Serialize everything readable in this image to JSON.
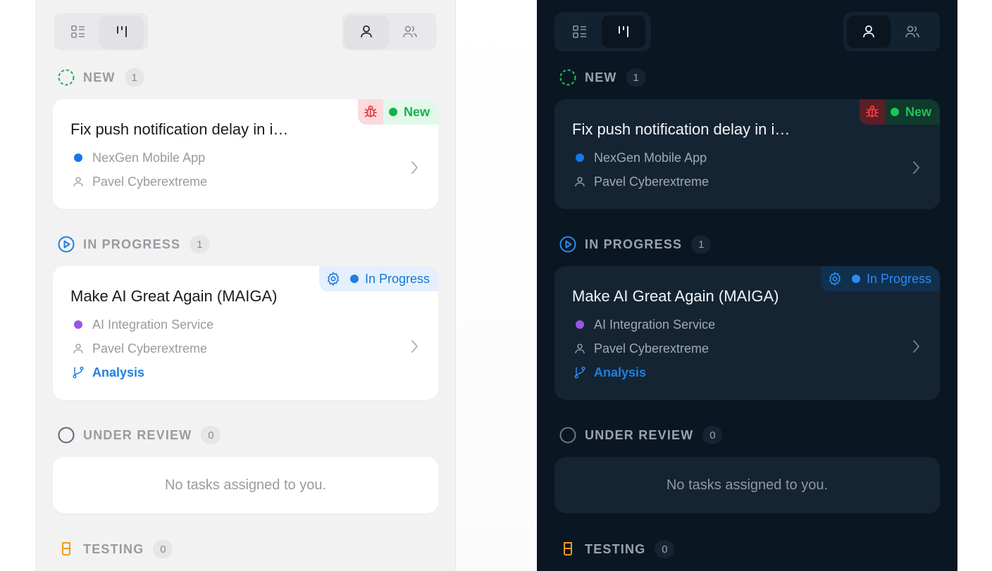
{
  "colors": {
    "new_green": "#16b14f",
    "progress_blue": "#1f7fe0",
    "bug_red": "#e53945",
    "testing_orange": "#f39a1f",
    "project_blue": "#1577e8",
    "project_purple": "#9a55e6",
    "light_panel_bg": "#f2f2f3",
    "dark_panel_bg": "#0a1722"
  },
  "toolbar": {
    "view_toggle": [
      "list-view-icon",
      "board-view-icon"
    ],
    "scope_toggle": [
      "my-tasks-icon",
      "team-tasks-icon"
    ]
  },
  "sections": {
    "new": {
      "label": "NEW",
      "count": "1"
    },
    "in_progress": {
      "label": "IN PROGRESS",
      "count": "1"
    },
    "under_review": {
      "label": "UNDER REVIEW",
      "count": "0"
    },
    "testing": {
      "label": "TESTING",
      "count": "0"
    }
  },
  "tasks": [
    {
      "title": "Fix push notification delay in i…",
      "status": "New",
      "type_icon": "bug-icon",
      "project": "NexGen Mobile App",
      "assignee": "Pavel Cyberextreme"
    },
    {
      "title": "Make AI Great Again (MAIGA)",
      "status": "In Progress",
      "type_icon": "gear-icon",
      "project": "AI Integration Service",
      "assignee": "Pavel Cyberextreme",
      "branch": "Analysis"
    }
  ],
  "empty_message": "No tasks assigned to you."
}
